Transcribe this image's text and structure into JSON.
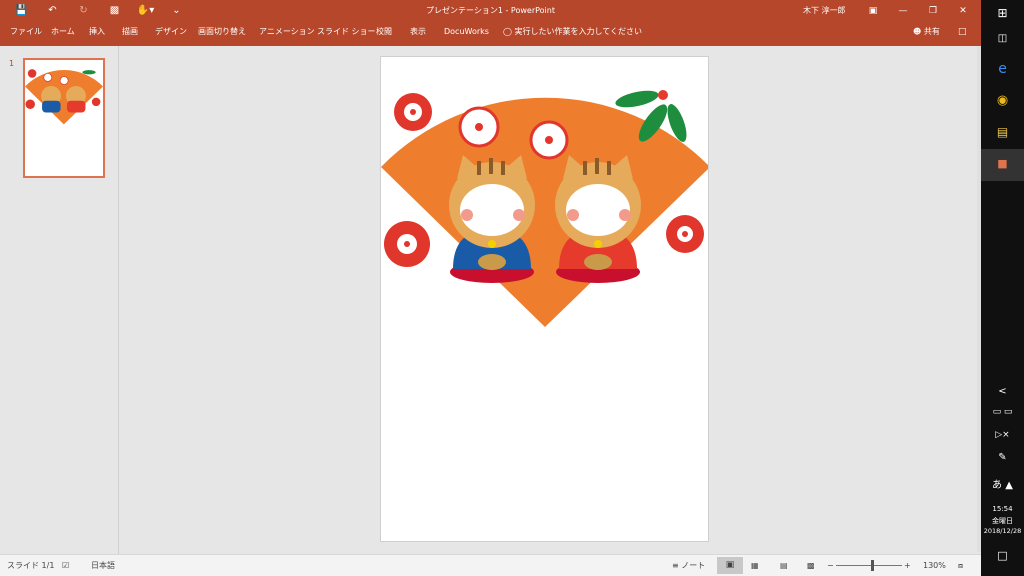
{
  "window": {
    "title": "プレゼンテーション1  -  PowerPoint",
    "user": "木下 淳一郎"
  },
  "ribbon": {
    "tabs": [
      "ファイル",
      "ホーム",
      "挿入",
      "描画",
      "デザイン",
      "画面切り替え",
      "アニメーション",
      "スライド ショー",
      "校閲",
      "表示",
      "DocuWorks"
    ],
    "tell_me": "実行したい作業を入力してください",
    "share": "共有"
  },
  "thumbnails": {
    "slide_number": "1"
  },
  "status": {
    "slide_info": "スライド 1/1",
    "language": "日本語",
    "notes": "ノート",
    "zoom_minus": "−",
    "zoom_plus": "+",
    "zoom": "130%"
  },
  "taskbar": {
    "ime": "あ",
    "time": "15:54",
    "day": "金曜日",
    "date": "2018/12/28"
  },
  "colors": {
    "accent": "#b7472a",
    "fan": "#ee7d2e",
    "blossom_red": "#e0362c",
    "kimono_blue": "#1a5ba8",
    "kimono_red": "#e53a2c",
    "cushion": "#c8102e",
    "boar_fur": "#e5ab5a",
    "leaf": "#1e8e3e"
  },
  "icons": {
    "qat": [
      "save-icon",
      "undo-icon",
      "redo-icon",
      "start-slideshow-icon",
      "touch-mode-icon",
      "customize-qat-icon"
    ],
    "window_buttons": [
      "ribbon-display-options-icon",
      "minimize-icon",
      "restore-icon",
      "close-icon"
    ],
    "taskbar": [
      "windows-start-icon",
      "task-view-icon",
      "edge-icon",
      "chrome-icon",
      "file-explorer-icon",
      "powerpoint-icon"
    ]
  }
}
